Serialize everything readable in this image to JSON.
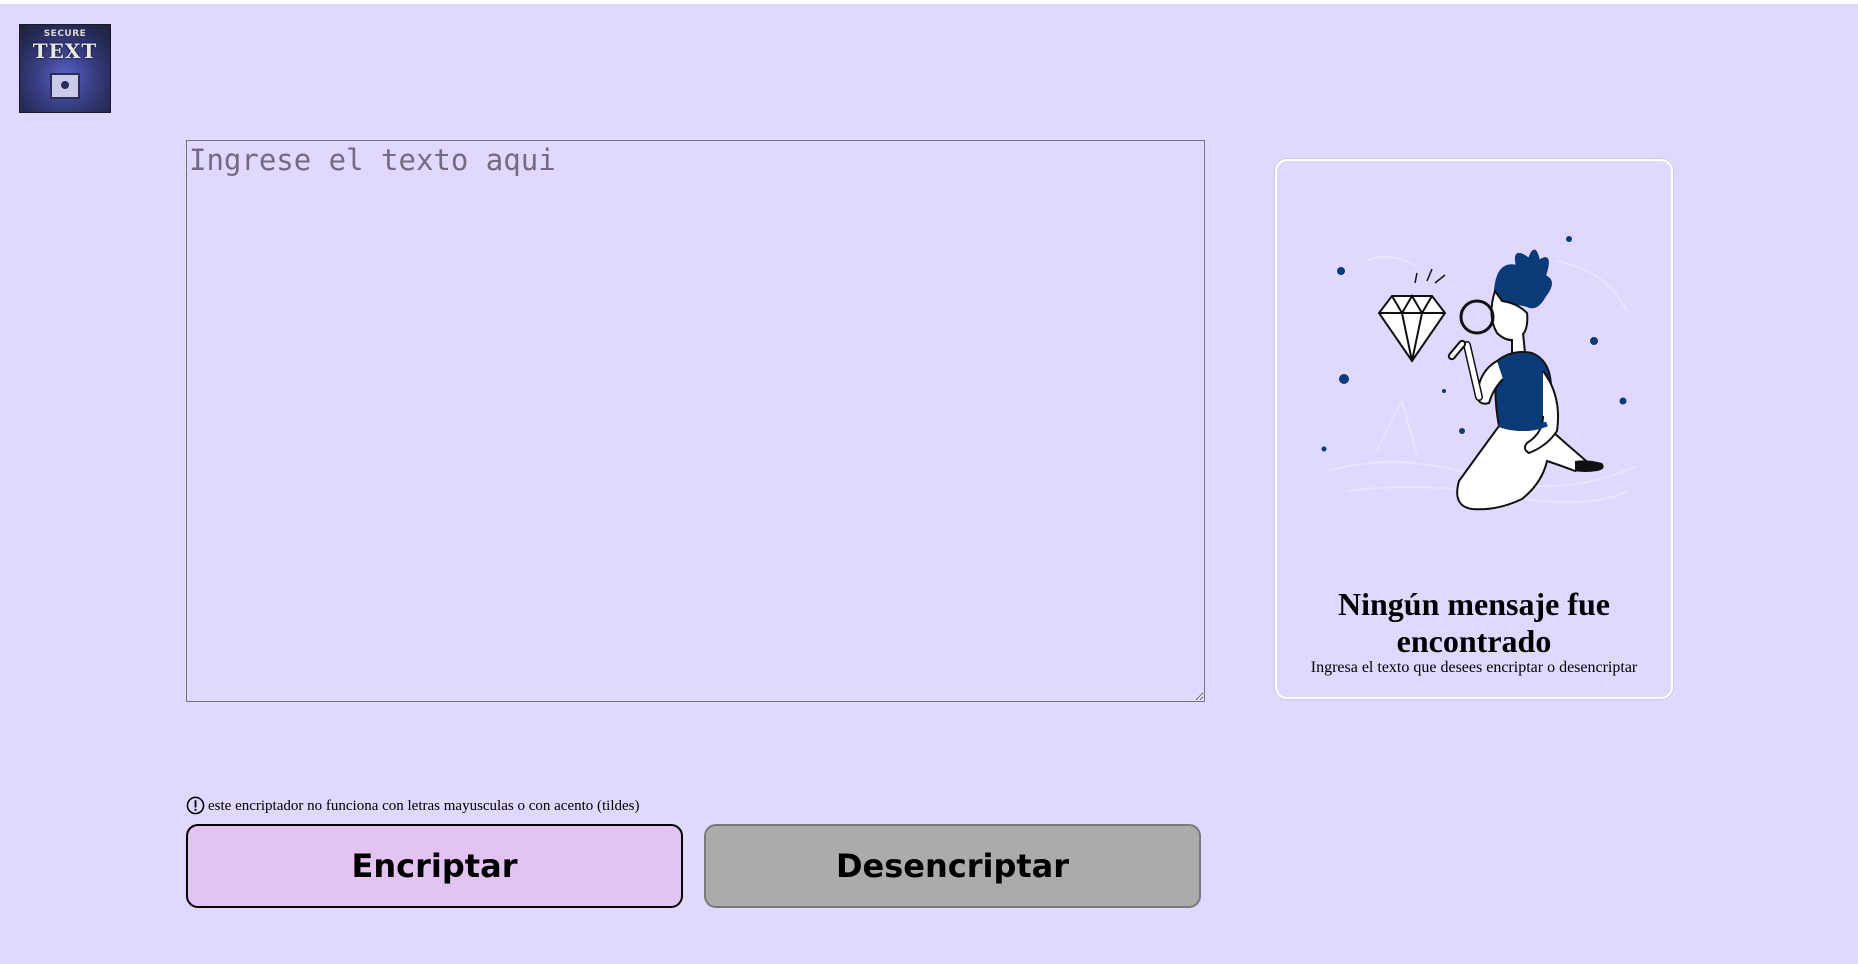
{
  "header": {
    "logo": {
      "icon": "secure-text-logo",
      "line1": "SECURE",
      "line2": "TEXT"
    }
  },
  "editor": {
    "placeholder": "Ingrese el texto aqui",
    "value": ""
  },
  "result": {
    "illustration": "person-with-magnifying-glass-and-diamond",
    "title": "Ningún mensaje fue encontrado",
    "subtitle": "Ingresa el texto que desees encriptar o desencriptar"
  },
  "notice": {
    "icon": "exclamation-circle-icon",
    "text": "este encriptador no funciona con letras mayusculas o con acento (tildes)"
  },
  "actions": {
    "encrypt_label": "Encriptar",
    "decrypt_label": "Desencriptar"
  },
  "colors": {
    "background": "#e0d8ff",
    "encrypt_button": "#e3c3f2",
    "decrypt_button": "#ababab",
    "illustration_accent": "#0b3a78"
  }
}
